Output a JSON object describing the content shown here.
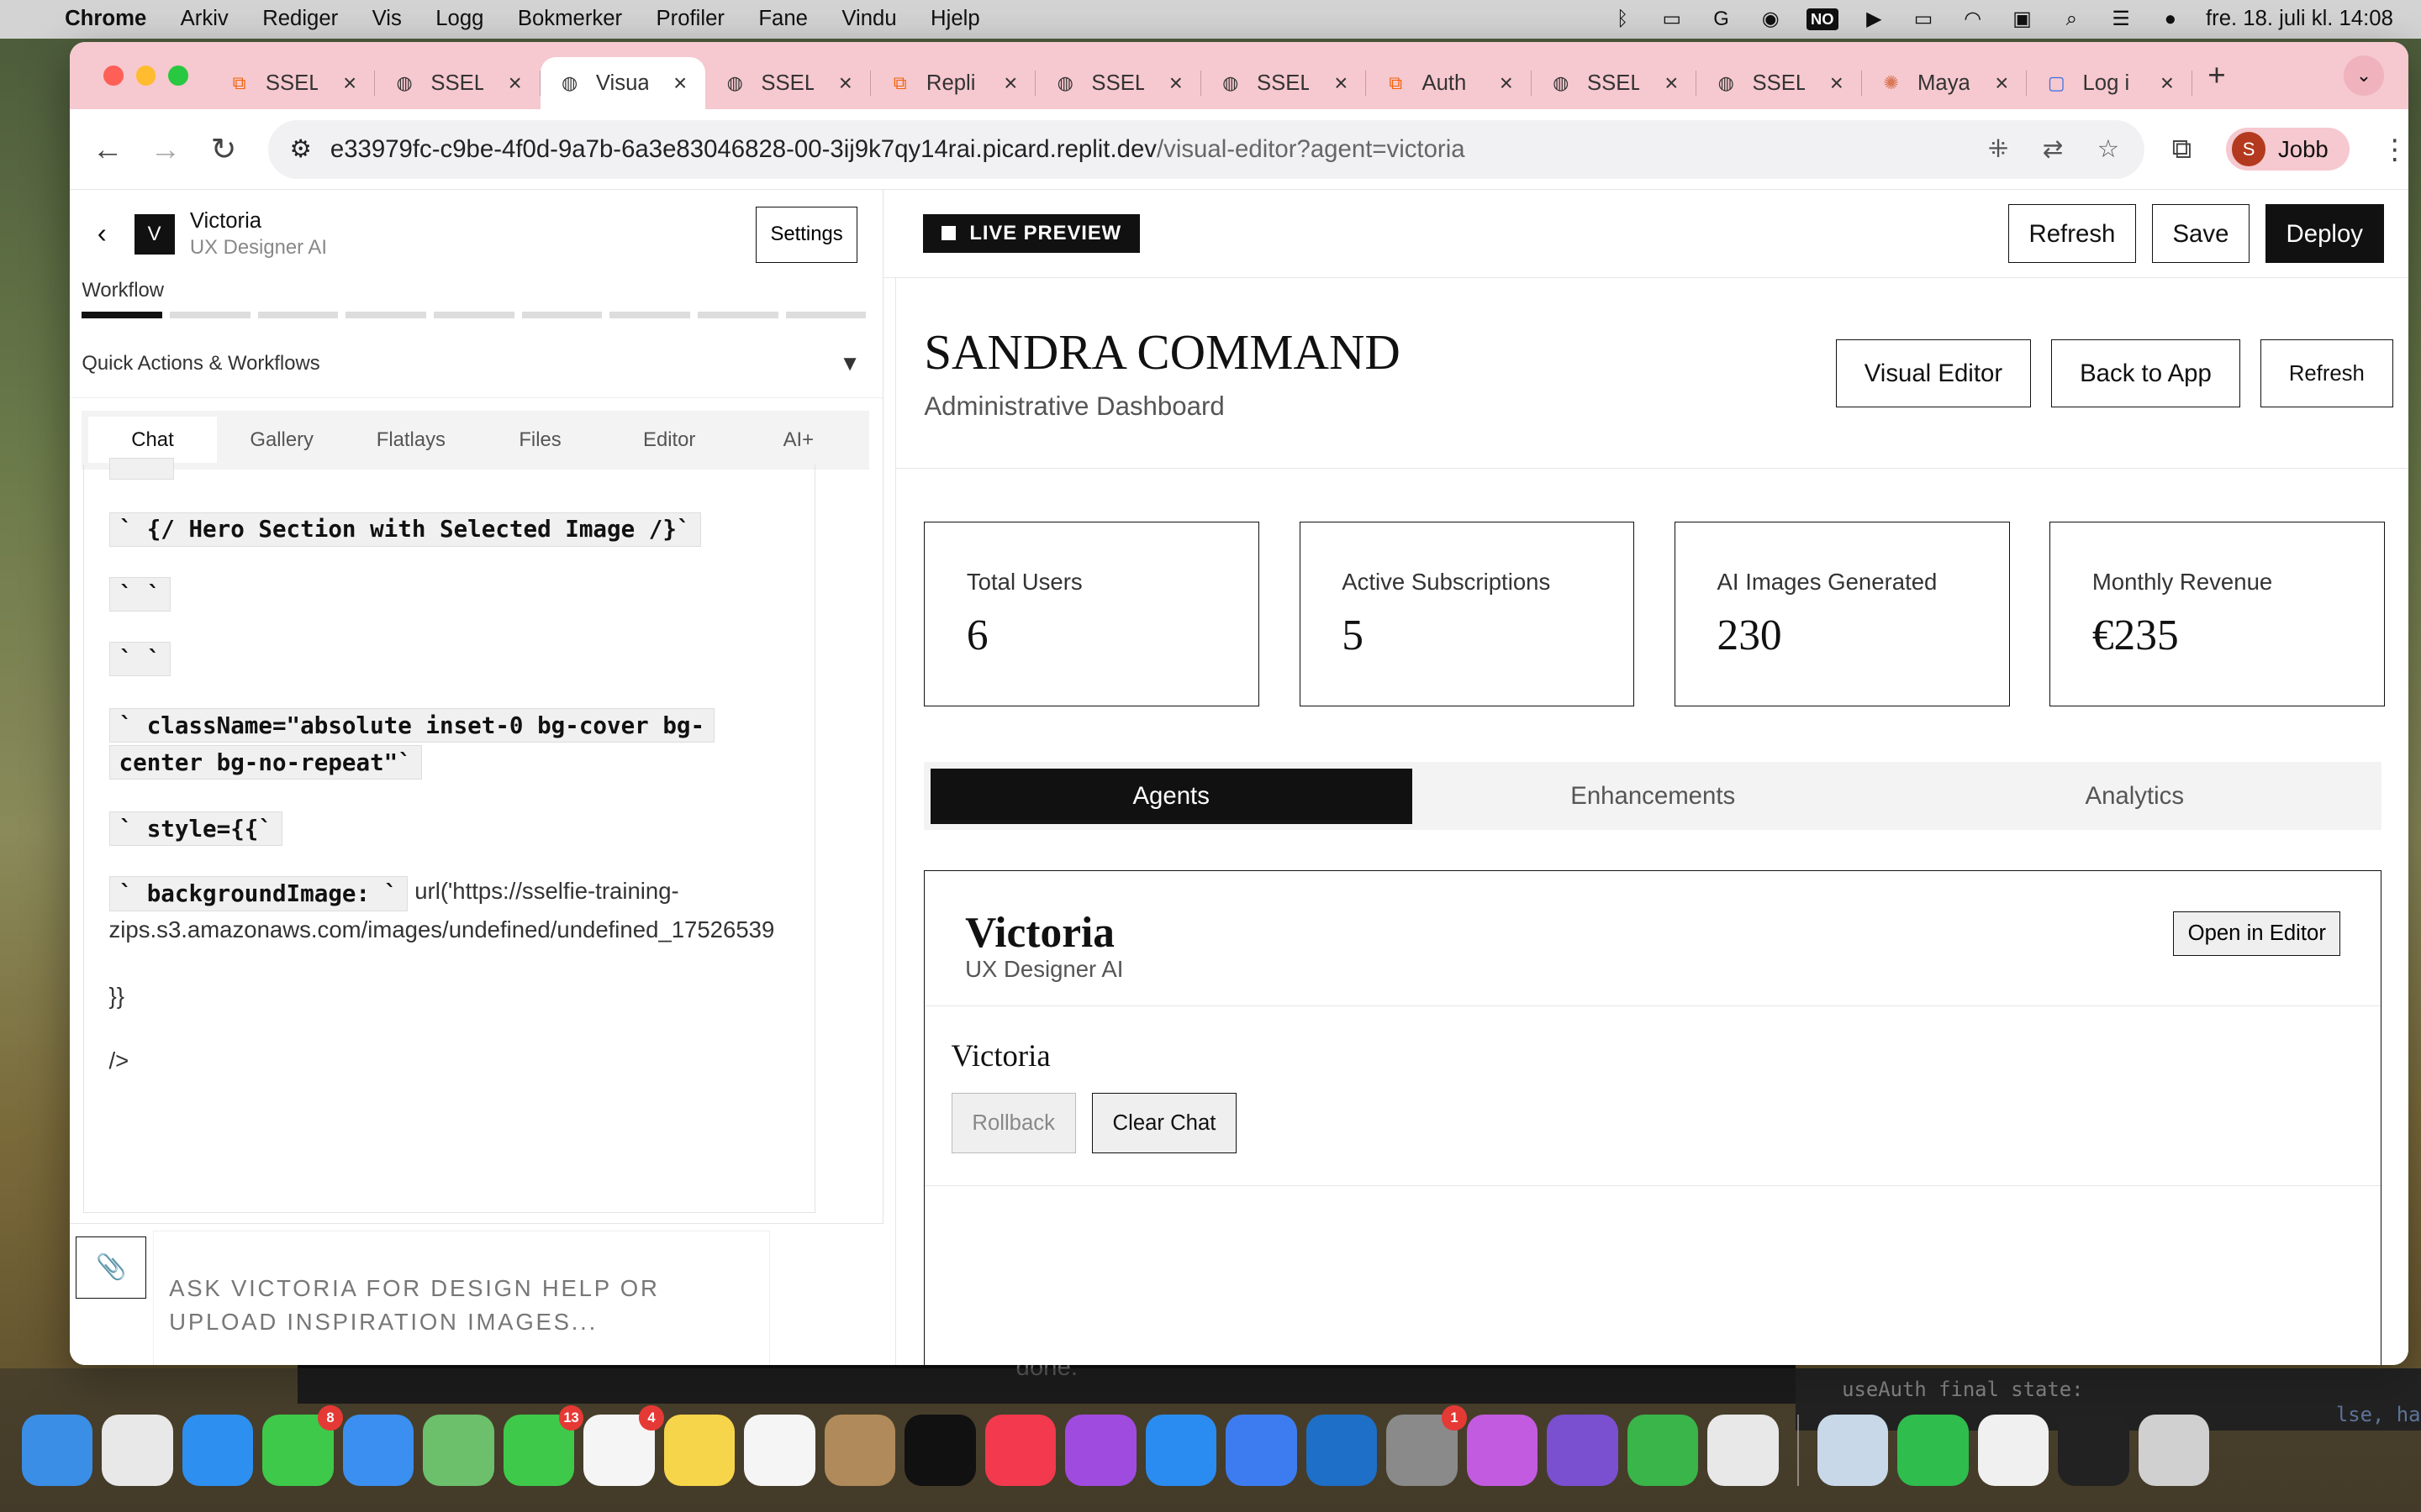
{
  "menubar": {
    "app": "Chrome",
    "items": [
      "Arkiv",
      "Rediger",
      "Vis",
      "Logg",
      "Bokmerker",
      "Profiler",
      "Fane",
      "Vindu",
      "Hjelp"
    ],
    "input_source": "NO",
    "datetime": "fre. 18. juli kl. 14:08"
  },
  "tabs": [
    {
      "title": "SSEL",
      "icon": "replit-icon"
    },
    {
      "title": "SSEL",
      "icon": "globe-icon"
    },
    {
      "title": "Visua",
      "icon": "globe-icon",
      "active": true
    },
    {
      "title": "SSEL",
      "icon": "globe-icon"
    },
    {
      "title": "Repli",
      "icon": "replit-icon"
    },
    {
      "title": "SSEL",
      "icon": "globe-icon"
    },
    {
      "title": "SSEL",
      "icon": "globe-icon"
    },
    {
      "title": "Auth",
      "icon": "replit-icon"
    },
    {
      "title": "SSEL",
      "icon": "globe-icon"
    },
    {
      "title": "SSEL",
      "icon": "globe-icon"
    },
    {
      "title": "Maya",
      "icon": "claude-icon"
    },
    {
      "title": "Log i",
      "icon": "login-icon"
    }
  ],
  "address": {
    "url_main": "e33979fc-c9be-4f0d-9a7b-6a3e83046828-00-3ij9k7qy14rai.picard.replit.dev",
    "url_path": "/visual-editor?agent=victoria"
  },
  "profile": {
    "initial": "S",
    "name": "Jobb"
  },
  "left": {
    "back": "‹",
    "avatar_letter": "V",
    "name": "Victoria",
    "role": "UX Designer AI",
    "settings": "Settings",
    "workflow_label": "Workflow",
    "quick_actions": "Quick Actions & Workflows",
    "tabs": [
      "Chat",
      "Gallery",
      "Flatlays",
      "Files",
      "Editor",
      "AI+"
    ],
    "chat_lines": {
      "l1": "` {/ Hero Section with Selected Image /}`",
      "l2": "` `",
      "l3": "` `",
      "l4a": "` className=\"absolute inset-0 bg-cover bg-",
      "l4b": "center bg-no-repeat\"`",
      "l5": "` style={{`",
      "l6a": "` backgroundImage: `",
      "l6b": "url('https://sselfie-training-",
      "l6c": "zips.s3.amazonaws.com/images/undefined/undefined_17526539",
      "l7": "}}",
      "l8": "/>"
    },
    "input_placeholder_1": "ASK VICTORIA FOR DESIGN HELP OR",
    "input_placeholder_2": "UPLOAD INSPIRATION IMAGES..."
  },
  "right": {
    "live": "LIVE PREVIEW",
    "refresh": "Refresh",
    "save": "Save",
    "deploy": "Deploy",
    "title": "SANDRA COMMAND",
    "subtitle": "Administrative Dashboard",
    "visual_editor": "Visual Editor",
    "back_to_app": "Back to App",
    "refresh2": "Refresh",
    "cards": [
      {
        "label": "Total Users",
        "value": "6"
      },
      {
        "label": "Active Subscriptions",
        "value": "5"
      },
      {
        "label": "AI Images Generated",
        "value": "230"
      },
      {
        "label": "Monthly Revenue",
        "value": "€235"
      }
    ],
    "tabs": [
      "Agents",
      "Enhancements",
      "Analytics"
    ],
    "agent": {
      "name": "Victoria",
      "role": "UX Designer AI",
      "open": "Open in Editor",
      "subname": "Victoria",
      "rollback": "Rollback",
      "clear": "Clear Chat"
    }
  },
  "terminal": {
    "line1": "useAuth final state:",
    "line2": "lse, ha"
  },
  "behind": {
    "text": "done."
  },
  "dock": [
    {
      "name": "finder-icon",
      "color": "#3a8ee6"
    },
    {
      "name": "launchpad-icon",
      "color": "#e8e8e8"
    },
    {
      "name": "safari-icon",
      "color": "#2d8ff0"
    },
    {
      "name": "messages-icon",
      "color": "#3ec94a",
      "badge": "8"
    },
    {
      "name": "mail-icon",
      "color": "#3b8ff0"
    },
    {
      "name": "maps-icon",
      "color": "#6cc06c"
    },
    {
      "name": "facetime-icon",
      "color": "#3ec94a",
      "badge": "13"
    },
    {
      "name": "reminders-icon",
      "color": "#f5f5f5",
      "badge": "4"
    },
    {
      "name": "notes-icon",
      "color": "#f7d54a"
    },
    {
      "name": "freeform-icon",
      "color": "#f5f5f5"
    },
    {
      "name": "contacts-icon",
      "color": "#b08a5a"
    },
    {
      "name": "appletv-icon",
      "color": "#111111"
    },
    {
      "name": "music-icon",
      "color": "#f2394d"
    },
    {
      "name": "podcasts-icon",
      "color": "#a04be0"
    },
    {
      "name": "appstore-icon",
      "color": "#2a8cf0"
    },
    {
      "name": "replit-dock-icon",
      "color": "#3d7cf0"
    },
    {
      "name": "outlook-icon",
      "color": "#1d6fc8"
    },
    {
      "name": "settings-icon",
      "color": "#8a8a8a",
      "badge": "1"
    },
    {
      "name": "creative-icon",
      "color": "#c25be0"
    },
    {
      "name": "github-icon",
      "color": "#7a4fd0"
    },
    {
      "name": "numbers-icon",
      "color": "#39b54a"
    },
    {
      "name": "chrome-icon",
      "color": "#e8e8e8"
    },
    {
      "name": "preview-icon",
      "color": "#c8d8e8"
    },
    {
      "name": "whatsapp-icon",
      "color": "#2fbd4e"
    },
    {
      "name": "photos-icon",
      "color": "#f0f0f0"
    },
    {
      "name": "perplexity-icon",
      "color": "#222222"
    },
    {
      "name": "trash-icon",
      "color": "#d0d0d0"
    }
  ]
}
